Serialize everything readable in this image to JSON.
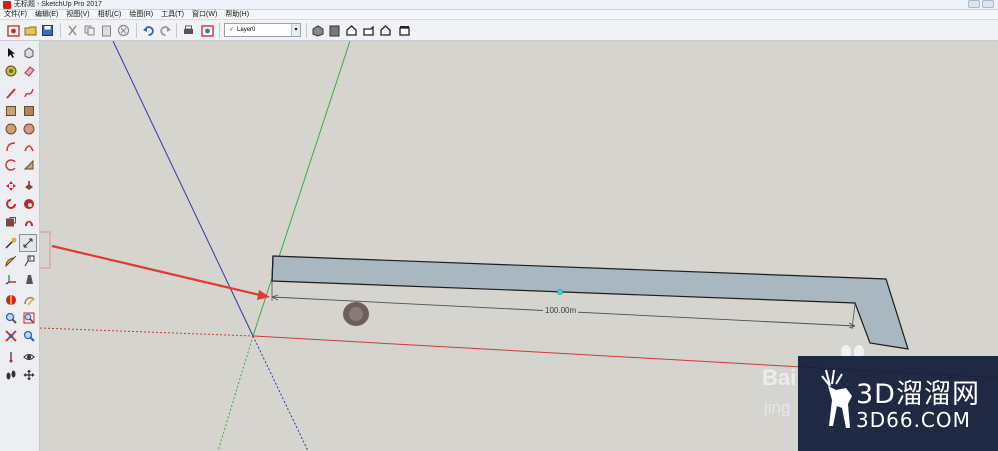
{
  "window": {
    "title": "无标题 - SketchUp Pro 2017"
  },
  "menu": {
    "items": [
      "文件(F)",
      "编辑(E)",
      "视图(V)",
      "相机(C)",
      "绘图(R)",
      "工具(T)",
      "窗口(W)",
      "帮助(H)"
    ]
  },
  "toolbar": {
    "layer_value": "Layer0"
  },
  "canvas": {
    "dimension_label": "100.00m",
    "colors": {
      "background": "#d5d4cf",
      "axis_red": "#cc3b3b",
      "axis_green": "#3faa3f",
      "axis_blue": "#3535a8",
      "face_fill": "#a9b7c0",
      "arrow": "#e23a33"
    }
  },
  "watermark": {
    "brand_cn": "3D溜溜网",
    "url": "3D66.COM",
    "baidu_text": "Bai",
    "baidu_sub": "jing"
  }
}
